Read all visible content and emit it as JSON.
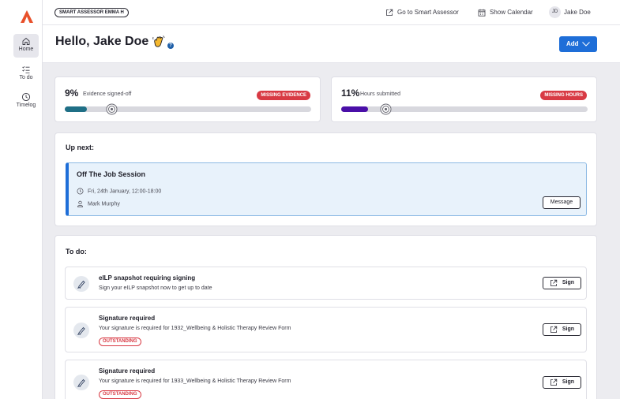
{
  "colors": {
    "brand_orange": "#e8502a",
    "accent_blue": "#1e6ed8",
    "evidence_teal": "#1f6f86",
    "hours_purple": "#4a0fa8",
    "missing_red": "#d83a44"
  },
  "sidebar": {
    "items": [
      {
        "label": "Home",
        "icon": "home-icon",
        "active": true
      },
      {
        "label": "To do",
        "icon": "checklist-icon",
        "active": false
      },
      {
        "label": "Timelog",
        "icon": "clock-icon",
        "active": false
      }
    ]
  },
  "topbar": {
    "assessor": "SMART ASSESSOR EMMA H",
    "go_to": "Go to Smart Assessor",
    "calendar": "Show Calendar",
    "user_initials": "JD",
    "user_name": "Jake Doe"
  },
  "header": {
    "greeting": "Hello, Jake Doe",
    "help": "?",
    "add_label": "Add"
  },
  "progress": {
    "evidence": {
      "percent": "9%",
      "label": "Evidence signed-off",
      "badge": "MISSING EVIDENCE",
      "fill": 0.09
    },
    "hours": {
      "percent": "11%",
      "label": "Hours submitted",
      "badge": "MISSING HOURS",
      "fill": 0.11
    }
  },
  "up_next": {
    "title": "Up next:",
    "session": {
      "title": "Off The Job Session",
      "datetime": "Fri, 24th January, 12:00-18:00",
      "person": "Mark Murphy",
      "message_label": "Message"
    }
  },
  "todo": {
    "title": "To do:",
    "items": [
      {
        "title": "eILP snapshot requiring signing",
        "desc": "Sign your eILP snapshot now to get up to date",
        "badge": "",
        "action": "Sign"
      },
      {
        "title": "Signature required",
        "desc": "Your signature is required for 1932_Wellbeing & Holistic Therapy Review Form",
        "badge": "OUTSTANDING",
        "action": "Sign"
      },
      {
        "title": "Signature required",
        "desc": "Your signature is required for 1933_Wellbeing & Holistic Therapy Review Form",
        "badge": "OUTSTANDING",
        "action": "Sign"
      }
    ]
  }
}
